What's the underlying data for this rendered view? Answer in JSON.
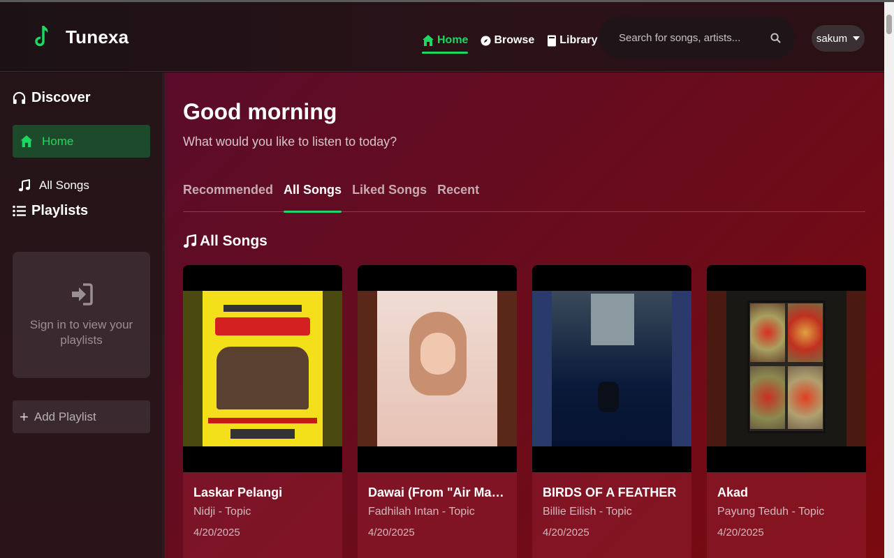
{
  "app": {
    "name": "Tunexa",
    "accent": "#1ed760"
  },
  "header": {
    "nav": [
      {
        "label": "Home",
        "icon": "home-icon",
        "active": true
      },
      {
        "label": "Browse",
        "icon": "compass-icon",
        "active": false
      },
      {
        "label": "Library",
        "icon": "book-icon",
        "active": false
      }
    ],
    "search_placeholder": "Search for songs, artists...",
    "user": "sakum"
  },
  "sidebar": {
    "discover_label": "Discover",
    "home_label": "Home",
    "all_songs_label": "All Songs",
    "playlists_label": "Playlists",
    "signin_text": "Sign in to view your playlists",
    "add_playlist_label": "Add Playlist"
  },
  "main": {
    "greeting": "Good morning",
    "subtitle": "What would you like to listen to today?",
    "tabs": [
      {
        "label": "Recommended",
        "active": false
      },
      {
        "label": "All Songs",
        "active": true
      },
      {
        "label": "Liked Songs",
        "active": false
      },
      {
        "label": "Recent",
        "active": false
      }
    ],
    "section_title": "All Songs",
    "songs": [
      {
        "title": "Laskar Pelangi",
        "artist": "Nidji - Topic",
        "date": "4/20/2025"
      },
      {
        "title": "Dawai (From \"Air Mata Di...",
        "artist": "Fadhilah Intan - Topic",
        "date": "4/20/2025"
      },
      {
        "title": "BIRDS OF A FEATHER",
        "artist": "Billie Eilish - Topic",
        "date": "4/20/2025"
      },
      {
        "title": "Akad",
        "artist": "Payung Teduh - Topic",
        "date": "4/20/2025"
      }
    ]
  }
}
